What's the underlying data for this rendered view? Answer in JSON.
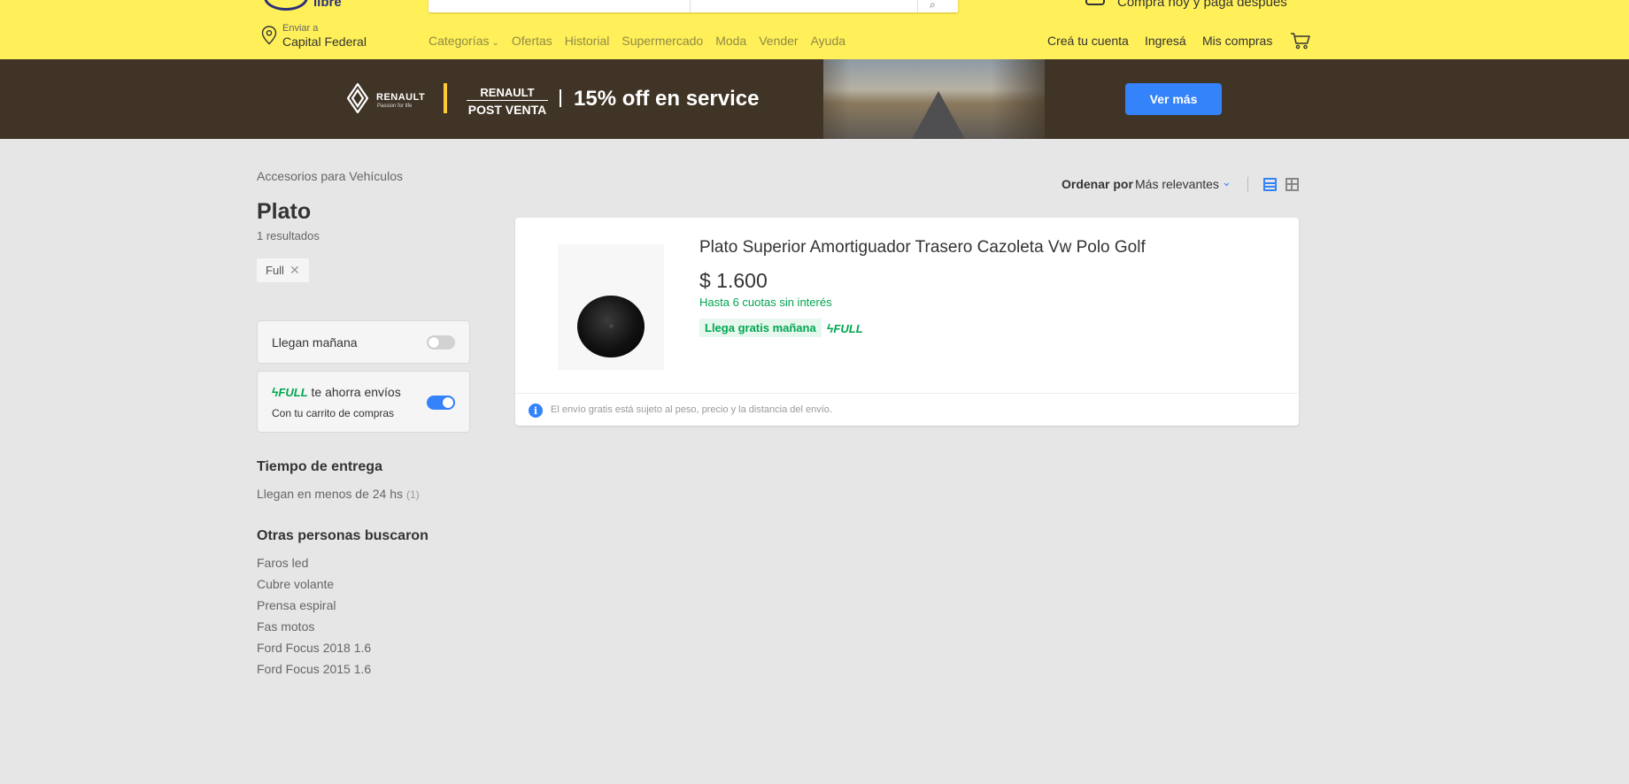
{
  "header": {
    "logo_text": "libre",
    "promo_text": "Comprá hoy y pagá después",
    "location": {
      "small": "Enviar a",
      "big": "Capital Federal"
    },
    "nav": [
      "Categorías",
      "Ofertas",
      "Historial",
      "Supermercado",
      "Moda",
      "Vender",
      "Ayuda"
    ],
    "account": {
      "create": "Creá tu cuenta",
      "login": "Ingresá",
      "purchases": "Mis compras"
    }
  },
  "banner": {
    "brand": "RENAULT",
    "tagline": "Passion for life",
    "pv_top": "RENAULT",
    "pv_bottom": "POST VENTA",
    "offer": "15% off en service",
    "cta": "Ver más"
  },
  "sidebar": {
    "breadcrumb": "Accesorios para Vehículos",
    "title": "Plato",
    "results": "1 resultados",
    "chip": "Full",
    "filter1": "Llegan mañana",
    "filter2": {
      "full": "FULL",
      "text": " te ahorra envíos",
      "sub": "Con tu carrito de compras"
    },
    "delivery_title": "Tiempo de entrega",
    "delivery_link": "Llegan en menos de 24 hs",
    "delivery_count": "(1)",
    "others_title": "Otras personas buscaron",
    "others": [
      "Faros led",
      "Cubre volante",
      "Prensa espiral",
      "Fas motos",
      "Ford Focus 2018 1.6",
      "Ford Focus 2015 1.6"
    ]
  },
  "sort": {
    "label": "Ordenar por",
    "value": "Más relevantes"
  },
  "product": {
    "title": "Plato Superior Amortiguador Trasero Cazoleta Vw Polo Golf",
    "price": "$ 1.600",
    "installments": "Hasta 6 cuotas sin interés",
    "shipping": "Llega gratis mañana",
    "full": "FULL",
    "note": "El envío gratis está sujeto al peso, precio y la distancia del envío."
  },
  "colors": {
    "brand_yellow": "#fff059",
    "accent_blue": "#3483fa",
    "green": "#00a650"
  },
  "filters_state": {
    "llegan_manana": false,
    "full": true
  }
}
